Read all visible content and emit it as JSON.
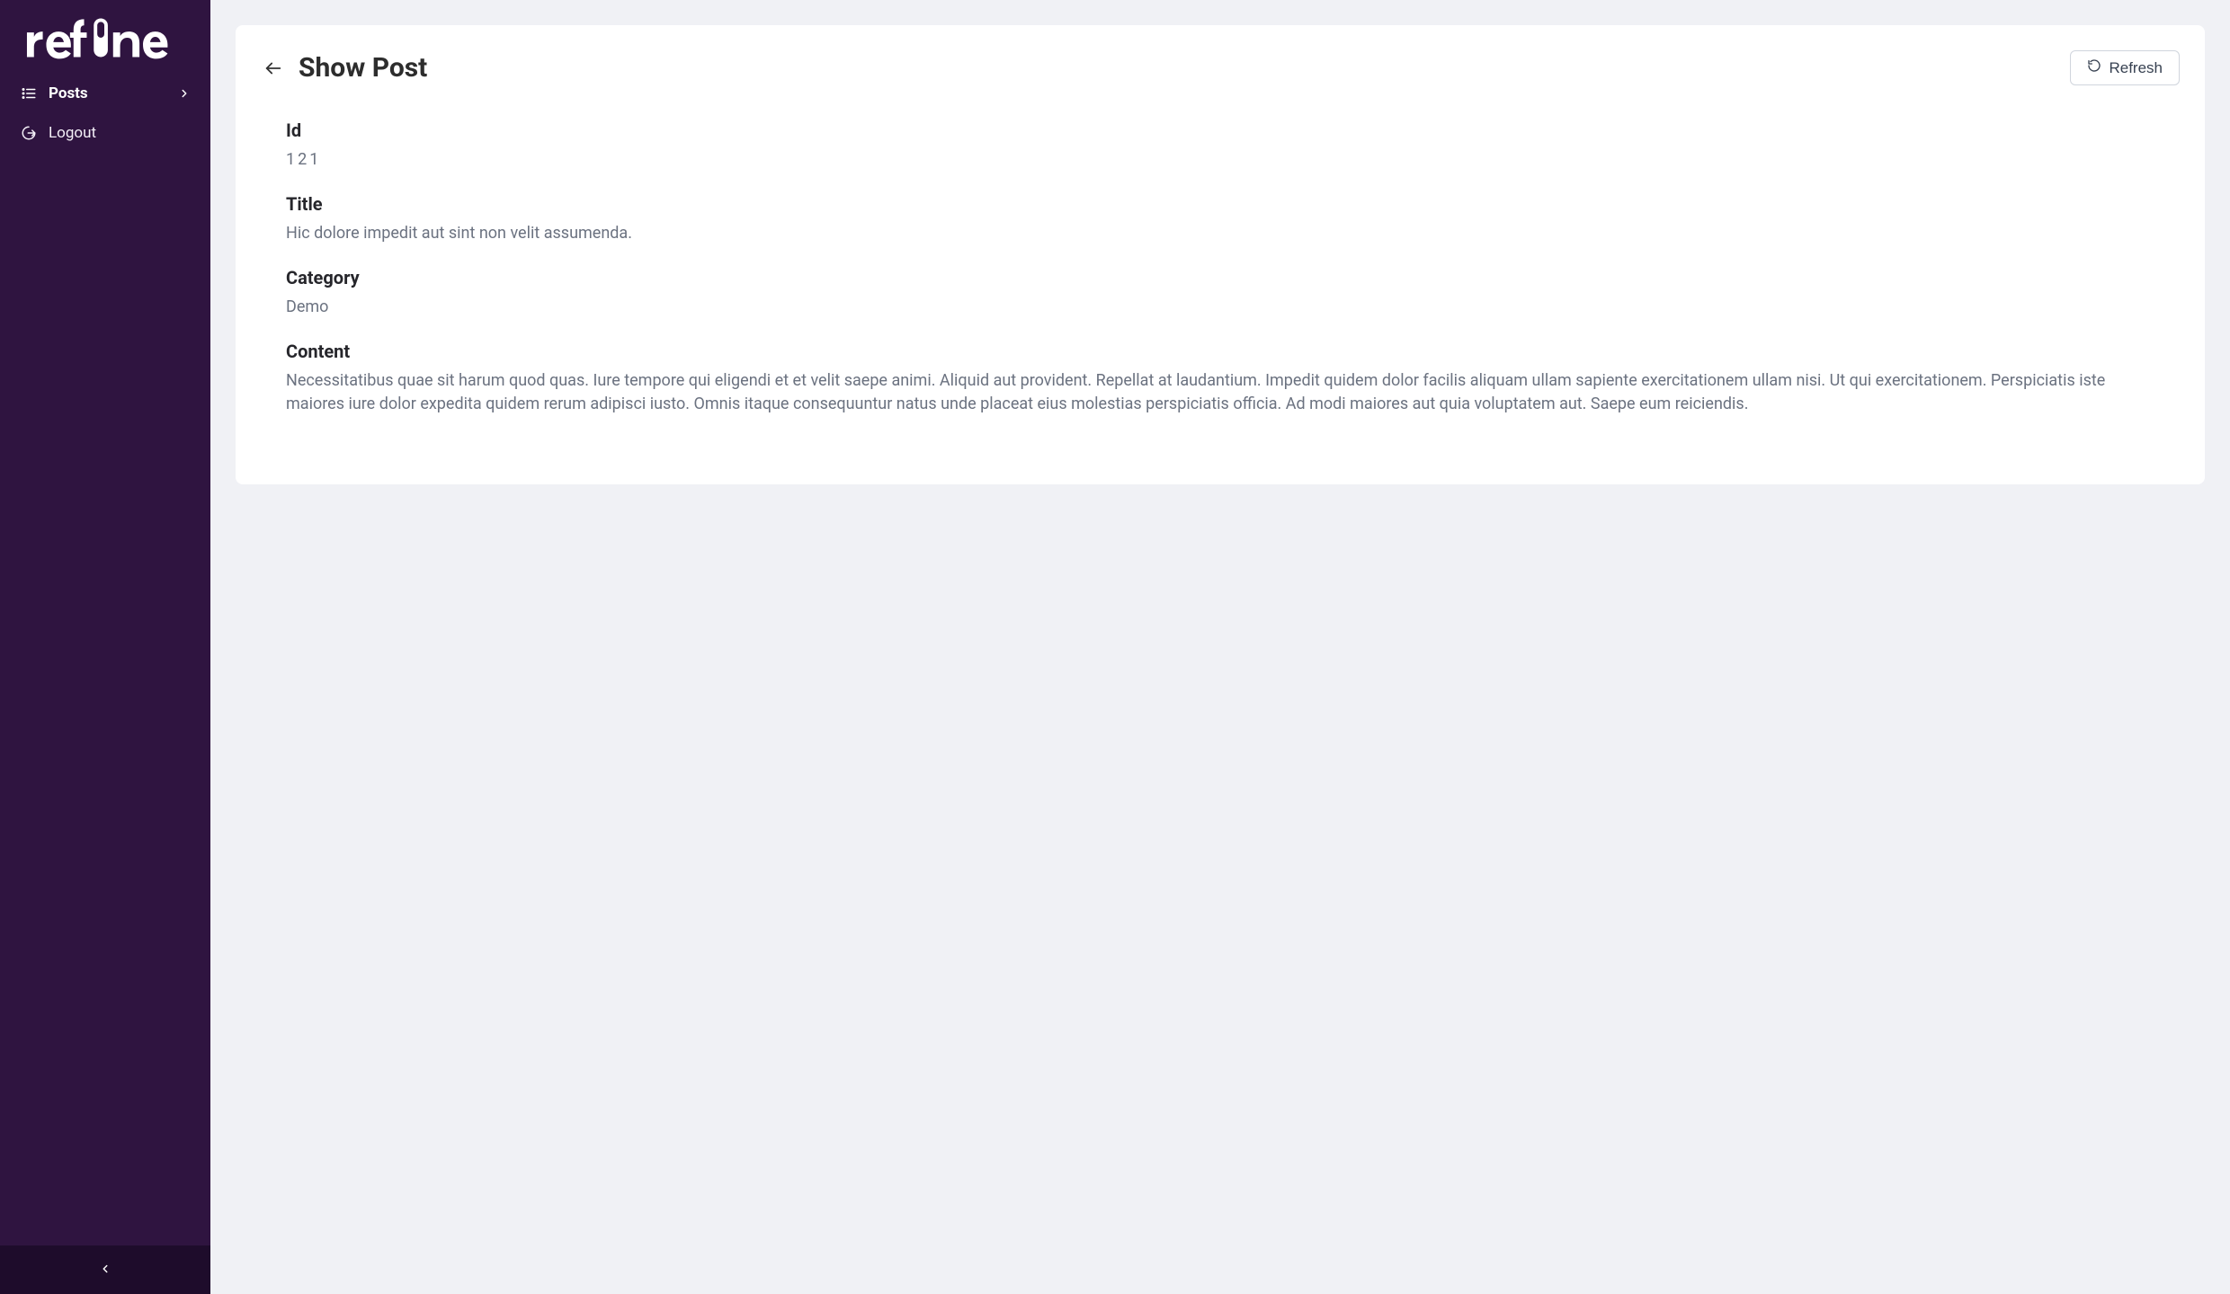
{
  "brand": "refine",
  "sidebar": {
    "items": [
      {
        "label": "Posts",
        "active": true
      },
      {
        "label": "Logout",
        "active": false
      }
    ]
  },
  "header": {
    "title": "Show Post",
    "refresh_label": "Refresh"
  },
  "fields": {
    "id": {
      "label": "Id",
      "value": "121"
    },
    "title": {
      "label": "Title",
      "value": "Hic dolore impedit aut sint non velit assumenda."
    },
    "category": {
      "label": "Category",
      "value": "Demo"
    },
    "content": {
      "label": "Content",
      "value": "Necessitatibus quae sit harum quod quas. Iure tempore qui eligendi et et velit saepe animi. Aliquid aut provident. Repellat at laudantium. Impedit quidem dolor facilis aliquam ullam sapiente exercitationem ullam nisi. Ut qui exercitationem. Perspiciatis iste maiores iure dolor expedita quidem rerum adipisci iusto. Omnis itaque consequuntur natus unde placeat eius molestias perspiciatis officia. Ad modi maiores aut quia voluptatem aut. Saepe eum reiciendis."
    }
  }
}
